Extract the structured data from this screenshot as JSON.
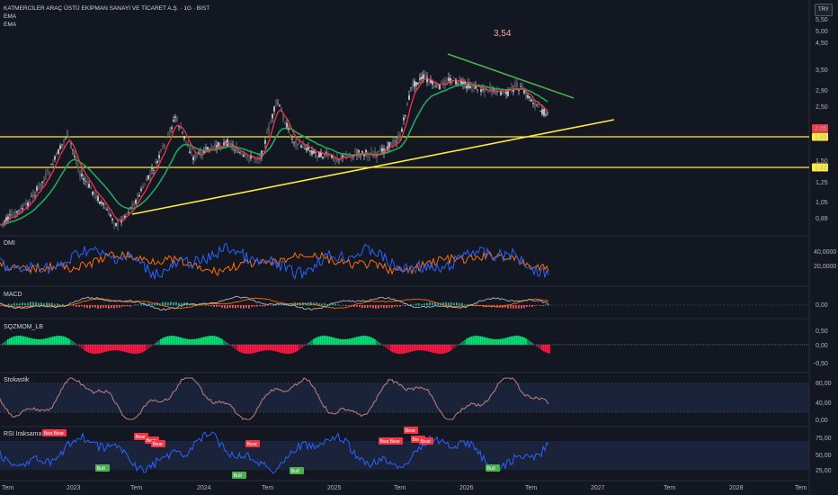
{
  "header": {
    "title": "KATMERCİLER ARAÇ ÜSTÜ EKİPMAN SANAYİ VE TİCARET A.Ş. · 1G · BIST",
    "indicators": [
      "EMA",
      "EMA"
    ]
  },
  "currency_button": "TRY",
  "annotation": "3,54",
  "price_axis": [
    "5,50",
    "5,00",
    "4,50",
    "3,50",
    "2,90",
    "2,50",
    "2,05",
    "1,89",
    "1,50",
    "1,43",
    "1,25",
    "1,05",
    "0,89"
  ],
  "price_tags": {
    "last": {
      "label": "2,05",
      "color": "#f23645"
    },
    "level_high": {
      "label": "1,89",
      "color": "#ffeb3b"
    },
    "level_low": {
      "label": "1,43",
      "color": "#ffeb3b"
    }
  },
  "panes": {
    "dmi": {
      "label": "DMI",
      "axis": [
        "40,0000",
        "20,0000"
      ]
    },
    "macd": {
      "label": "MACD",
      "axis": [
        "0,00"
      ]
    },
    "sqz": {
      "label": "SQZMOM_LB",
      "axis": [
        "0,50",
        "0,00",
        "-0,50"
      ]
    },
    "stoch": {
      "label": "Stokastik",
      "axis": [
        "80,00",
        "40,00",
        "0,00"
      ]
    },
    "rsi": {
      "label": "RSI Iraksama Göst.",
      "axis": [
        "75,00",
        "50,00",
        "25,00"
      ]
    }
  },
  "time_axis": [
    "Tem",
    "2023",
    "Tem",
    "2024",
    "Tem",
    "2025",
    "Tem",
    "2026",
    "Tem",
    "2027",
    "Tem",
    "2028",
    "Tem"
  ],
  "divergence_labels": {
    "bear": [
      "Bear",
      "Bear",
      "Bear",
      "Bear",
      "Bear",
      "Bear",
      "Bear",
      "Bear",
      "Bear",
      "Bear",
      "Bear"
    ],
    "bull": [
      "Bull",
      "Bull",
      "Bull",
      "Bull"
    ]
  },
  "colors": {
    "background": "#131722",
    "candle_up": "#e0e3eb",
    "candle_down": "#e0e3eb",
    "ema_fast": "#f23645",
    "ema_slow": "#26a65b",
    "trend_up": "#ffeb3b",
    "trend_down": "#4caf50",
    "horizontal_level": "#ffeb3b",
    "dmi_plus": "#2962ff",
    "dmi_minus": "#ff6d00",
    "sqz_up": "#00e676",
    "sqz_down": "#ff1744",
    "stoch": "#b07a7a",
    "rsi": "#2962ff",
    "bear_label": "#f23645",
    "bull_label": "#4caf50"
  }
}
